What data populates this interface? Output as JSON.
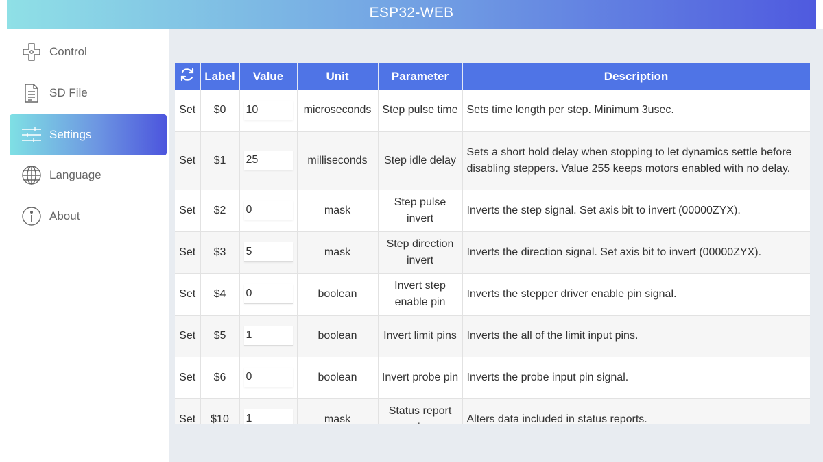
{
  "app": {
    "title": "ESP32-WEB"
  },
  "sidebar": {
    "items": [
      {
        "label": "Control",
        "icon": "dpad-icon",
        "active": false
      },
      {
        "label": "SD File",
        "icon": "document-icon",
        "active": false
      },
      {
        "label": "Settings",
        "icon": "sliders-icon",
        "active": true
      },
      {
        "label": "Language",
        "icon": "globe-icon",
        "active": false
      },
      {
        "label": "About",
        "icon": "info-icon",
        "active": false
      }
    ]
  },
  "table": {
    "headers": {
      "refresh_icon": "refresh-icon",
      "label": "Label",
      "value": "Value",
      "unit": "Unit",
      "parameter": "Parameter",
      "description": "Description"
    },
    "rows": [
      {
        "action": "Set",
        "label": "$0",
        "value": "10",
        "unit": "microseconds",
        "parameter": "Step pulse time",
        "description": "Sets time length per step. Minimum 3usec."
      },
      {
        "action": "Set",
        "label": "$1",
        "value": "25",
        "unit": "milliseconds",
        "parameter": "Step idle delay",
        "description": "Sets a short hold delay when stopping to let dynamics settle before disabling steppers. Value 255 keeps motors enabled with no delay."
      },
      {
        "action": "Set",
        "label": "$2",
        "value": "0",
        "unit": "mask",
        "parameter": "Step pulse invert",
        "description": "Inverts the step signal. Set axis bit to invert (00000ZYX)."
      },
      {
        "action": "Set",
        "label": "$3",
        "value": "5",
        "unit": "mask",
        "parameter": "Step direction invert",
        "description": "Inverts the direction signal. Set axis bit to invert (00000ZYX)."
      },
      {
        "action": "Set",
        "label": "$4",
        "value": "0",
        "unit": "boolean",
        "parameter": "Invert step enable pin",
        "description": "Inverts the stepper driver enable pin signal."
      },
      {
        "action": "Set",
        "label": "$5",
        "value": "1",
        "unit": "boolean",
        "parameter": "Invert limit pins",
        "description": "Inverts the all of the limit input pins."
      },
      {
        "action": "Set",
        "label": "$6",
        "value": "0",
        "unit": "boolean",
        "parameter": "Invert probe pin",
        "description": "Inverts the probe input pin signal."
      },
      {
        "action": "Set",
        "label": "$10",
        "value": "1",
        "unit": "mask",
        "parameter": "Status report options",
        "description": "Alters data included in status reports."
      }
    ]
  },
  "colors": {
    "header_blue": "#4f74e6",
    "gradient_start": "#8fe0e6",
    "gradient_end": "#4f5adf",
    "main_bg": "#e8ecf1"
  }
}
